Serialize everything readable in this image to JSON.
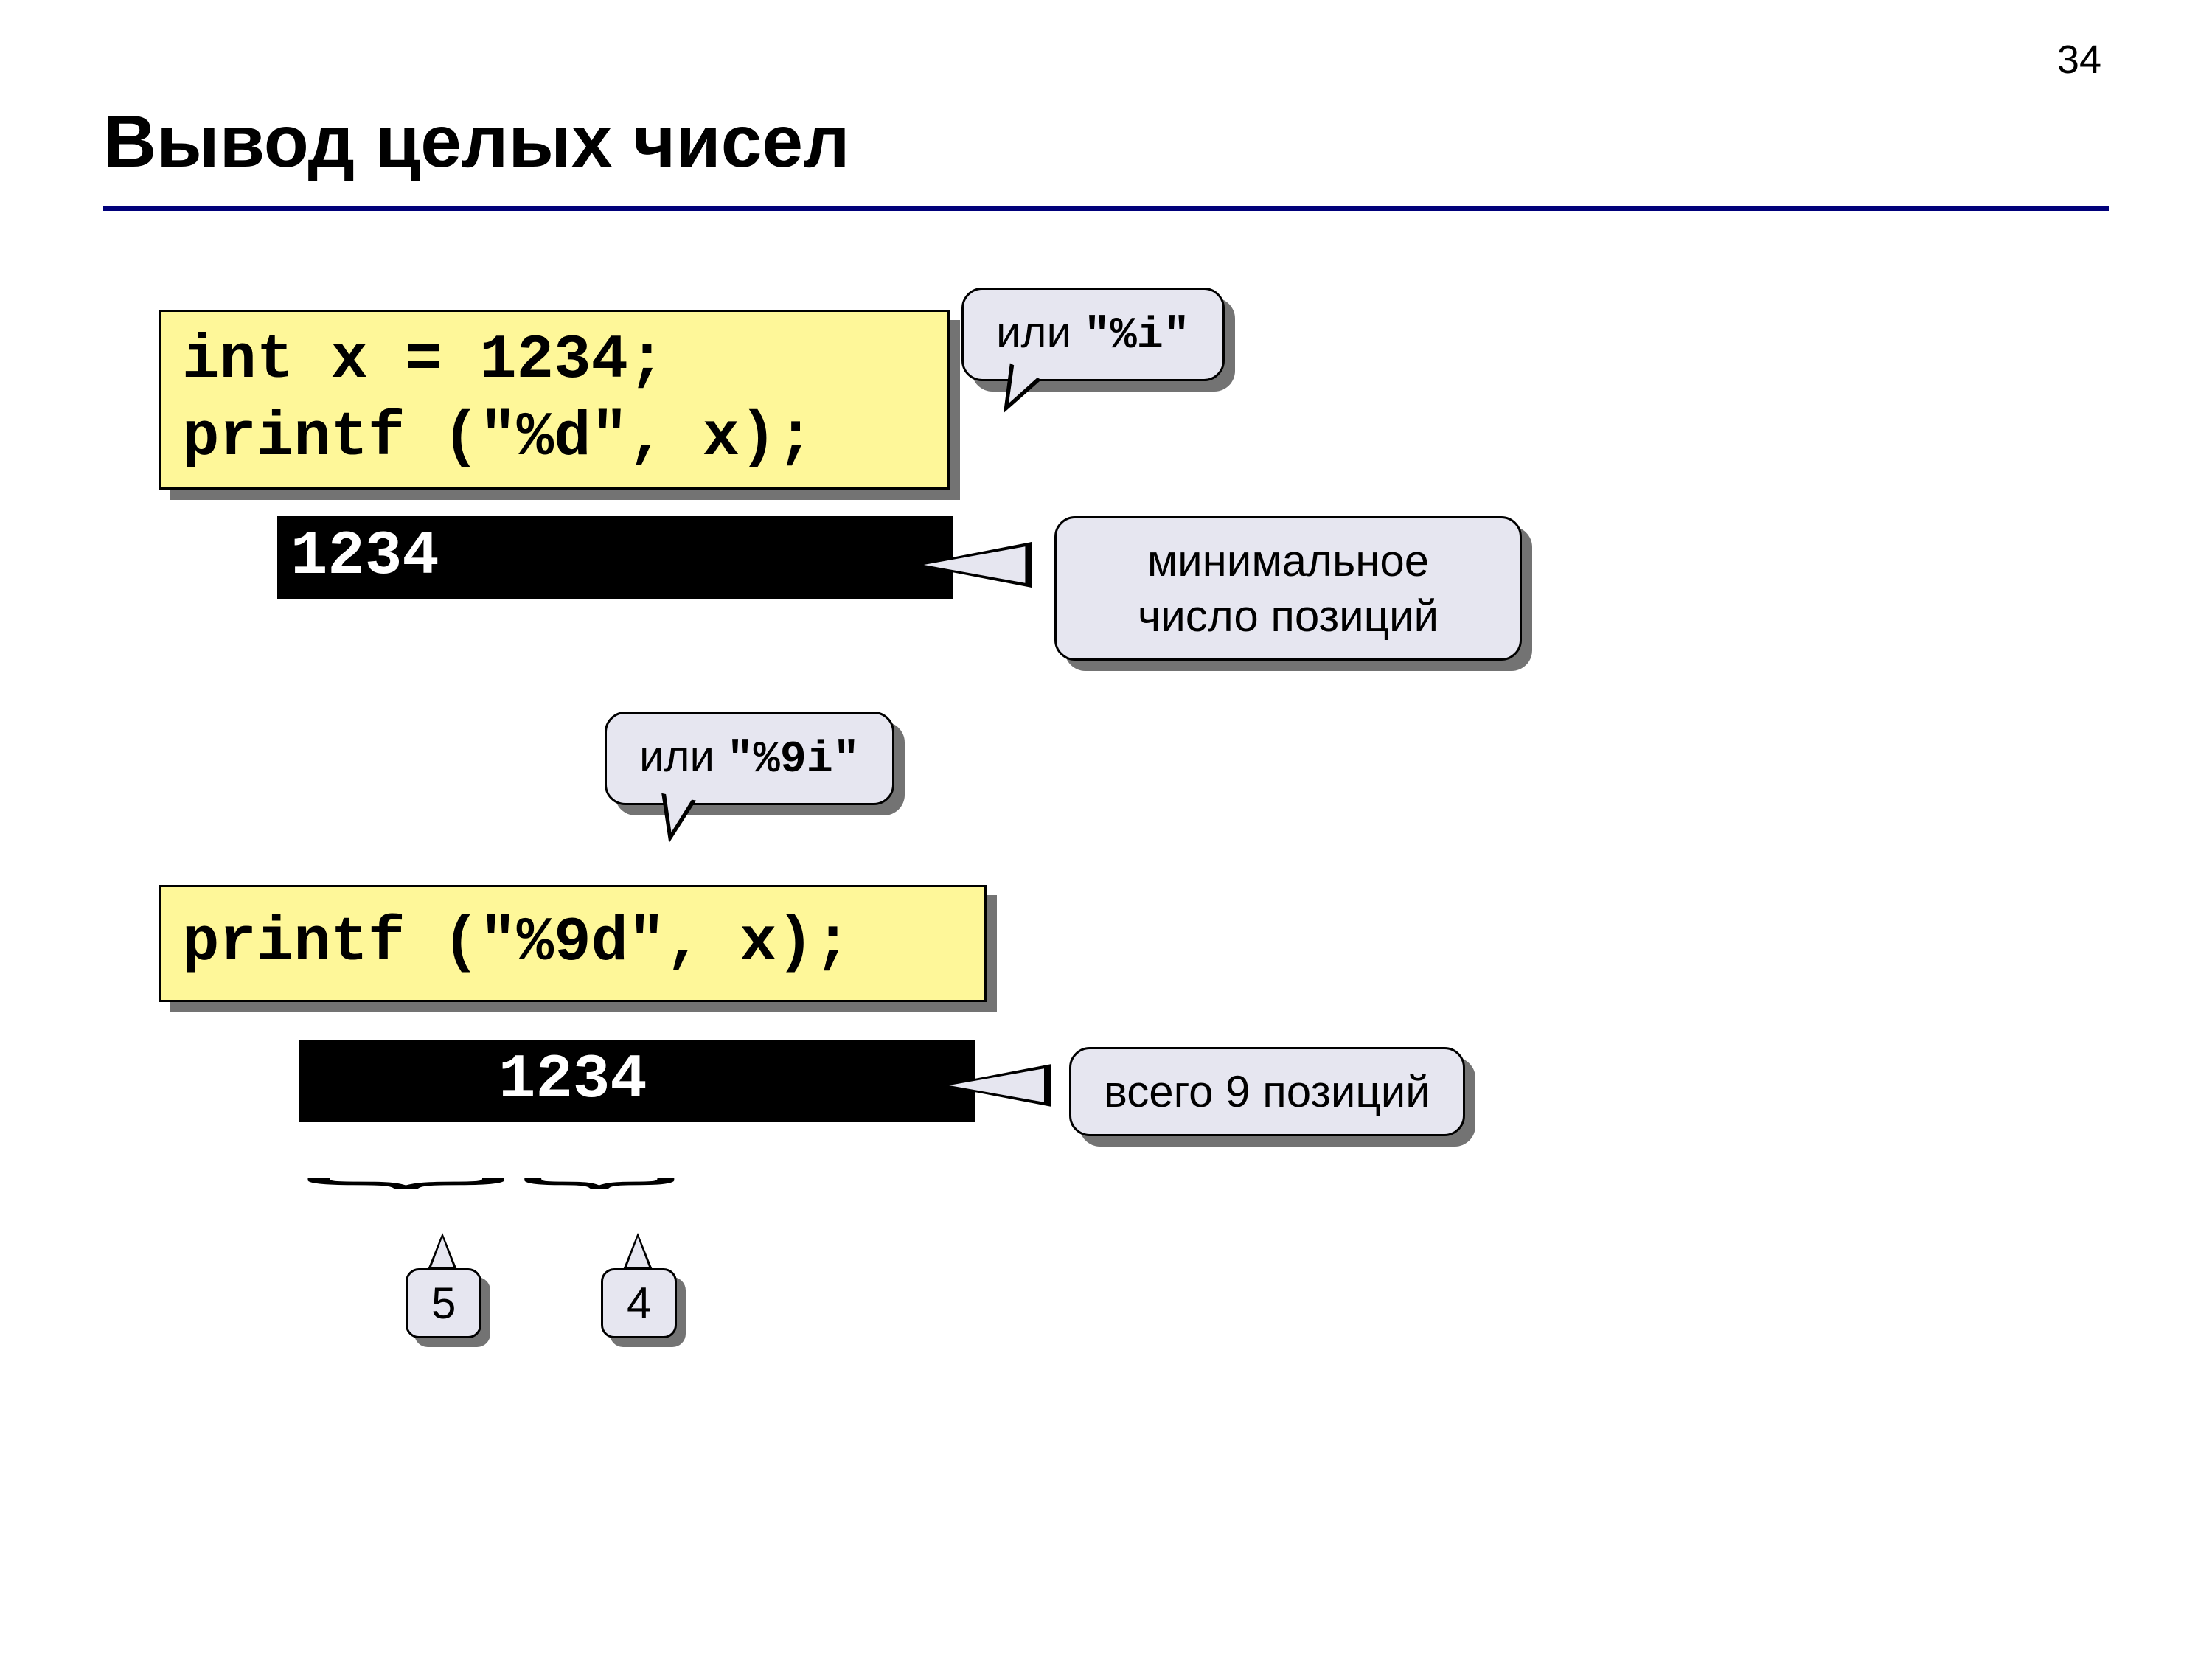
{
  "page_number": "34",
  "title": "Вывод целых чисел",
  "code1_line1": "int x = 1234;",
  "code1_line2": "printf (\"%d\", x);",
  "callout1_or": "или ",
  "callout1_fmt": "\"%i\"",
  "console1": "1234",
  "callout2_line1": "минимальное",
  "callout2_line2": "число позиций",
  "callout3_or": "или ",
  "callout3_fmt": "\"%9i\"",
  "code2": "printf (\"%9d\", x);",
  "console2": "     1234",
  "callout4": "всего 9 позиций",
  "brace_count1": "5",
  "brace_count2": "4"
}
